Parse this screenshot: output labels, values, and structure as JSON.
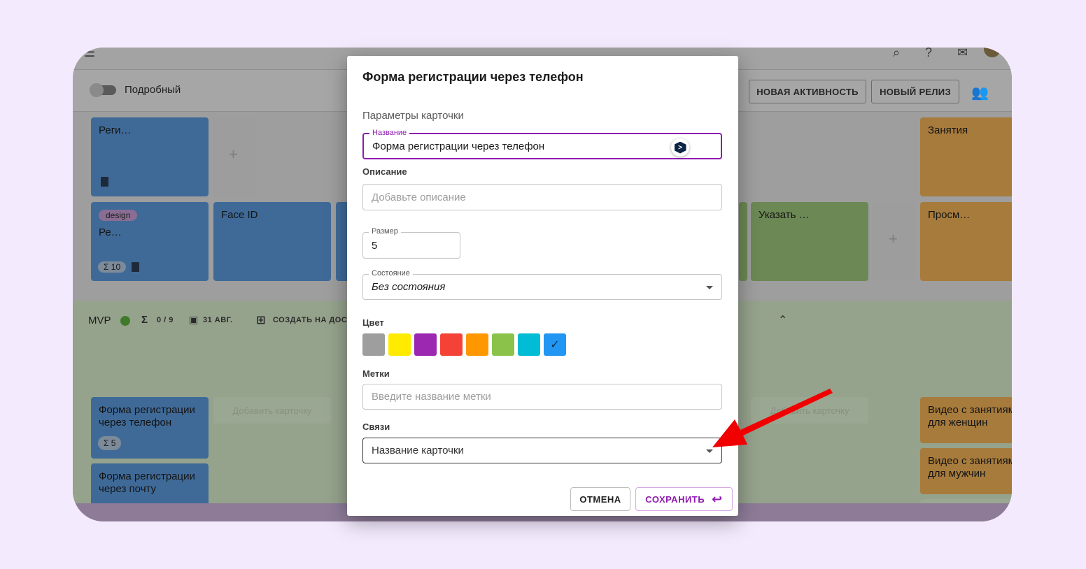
{
  "background_app": {
    "toolbar": {
      "toggle_label": "Подробный",
      "new_activity_label": "НОВАЯ АКТИВНОСТЬ",
      "new_release_label": "НОВЫЙ РЕЛИЗ"
    },
    "board_cards": {
      "card_reg": "Реги…",
      "card_design_tag": "design",
      "card_re": "Ре…",
      "card_re_points": "10",
      "card_faceid": "Face ID",
      "card_ukazat": "Указать …",
      "card_zanyatiya": "Занятия",
      "card_prosm": "Просм…"
    },
    "mvp": {
      "title": "MVP",
      "progress": "0 / 9",
      "date": "31 АВГ.",
      "create_on_board": "СОЗДАТЬ НА ДОСК",
      "card_phone": "Форма регистрации через телефон",
      "card_phone_points": "5",
      "card_mail": "Форма регистрации через почту",
      "add_card_label": "Добавить карточку",
      "card_video_women": "Видео с занятиями для женщин",
      "card_video_men": "Видео с занятиями для мужчин",
      "add_card_partial": "Добавить карточ"
    }
  },
  "dialog": {
    "title": "Форма регистрации через телефон",
    "section_title": "Параметры карточки",
    "name_field": {
      "legend": "Название",
      "value": "Форма регистрации через телефон"
    },
    "description": {
      "label": "Описание",
      "placeholder": "Добавьте описание"
    },
    "size_field": {
      "legend": "Размер",
      "value": "5"
    },
    "state_field": {
      "legend": "Состояние",
      "value": "Без состояния"
    },
    "color": {
      "label": "Цвет",
      "swatches": [
        "#9e9e9e",
        "#ffeb00",
        "#9c27b0",
        "#f44336",
        "#ff9800",
        "#8bc34a",
        "#00bcd4",
        "#2196f3"
      ],
      "selected_index": 7
    },
    "tags": {
      "label": "Метки",
      "placeholder": "Введите название метки"
    },
    "links": {
      "label": "Связи",
      "value": "Название карточки"
    },
    "buttons": {
      "cancel": "ОТМЕНА",
      "save": "СОХРАНИТЬ"
    }
  },
  "colors": {
    "accent": "#8f1bb0",
    "annotation_arrow": "#f00000"
  }
}
